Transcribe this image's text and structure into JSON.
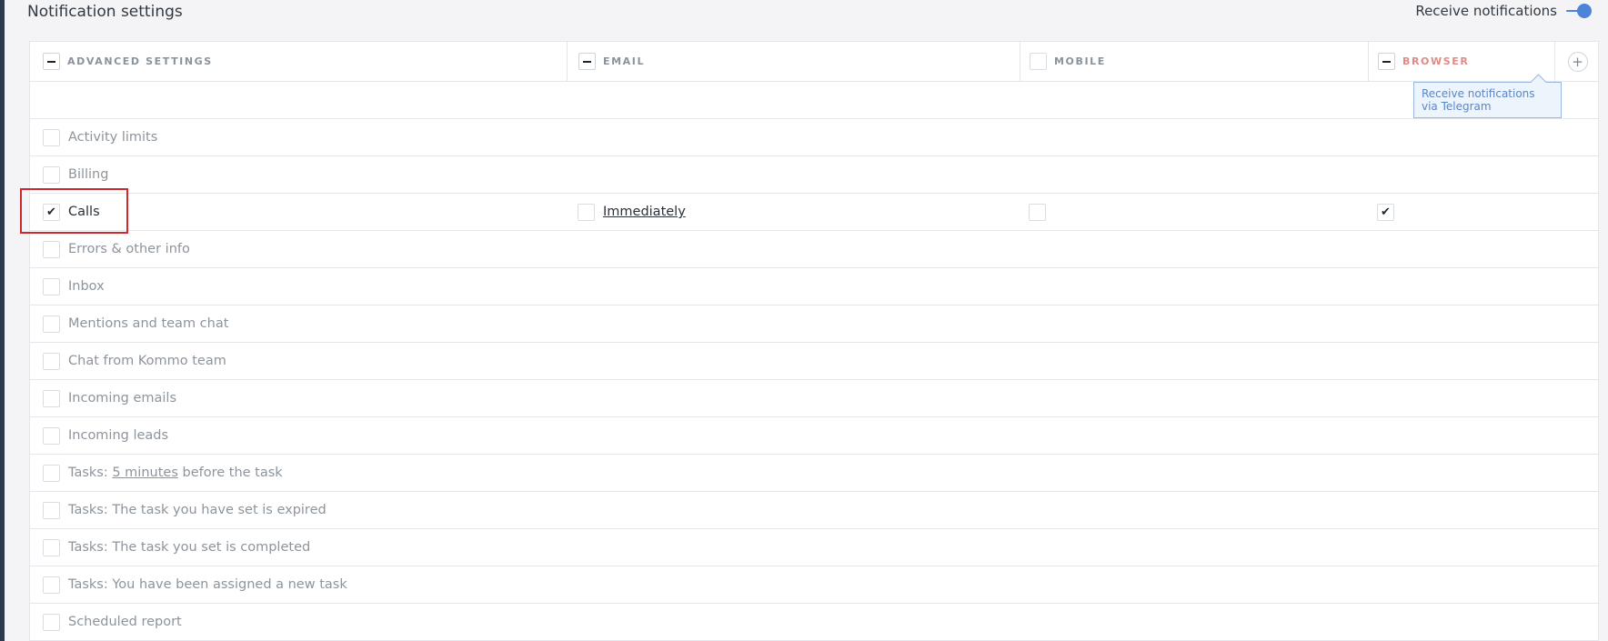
{
  "page": {
    "title": "Notification settings",
    "receive_label": "Receive notifications",
    "toggle_on": true,
    "accent_color": "#4d84d8"
  },
  "columns": {
    "advanced": "ADVANCED SETTINGS",
    "email": "EMAIL",
    "mobile": "MOBILE",
    "browser": "BROWSER"
  },
  "tooltip": {
    "text": "Receive notifications via Telegram"
  },
  "rows": [
    {
      "label": "Activity limits"
    },
    {
      "label": "Billing"
    },
    {
      "label": "Calls",
      "email_value": "Immediately"
    },
    {
      "label": "Errors & other info"
    },
    {
      "label": "Inbox"
    },
    {
      "label": "Mentions and team chat"
    },
    {
      "label": "Chat from Kommo team"
    },
    {
      "label": "Incoming emails"
    },
    {
      "label": "Incoming leads"
    },
    {
      "label_prefix": "Tasks:",
      "label_link": "5 minutes",
      "label_suffix": "before the task"
    },
    {
      "label": "Tasks: The task you have set is expired"
    },
    {
      "label": "Tasks: The task you set is completed"
    },
    {
      "label": "Tasks: You have been assigned a new task"
    },
    {
      "label": "Scheduled report"
    }
  ],
  "icons": {
    "checkmark": "✔",
    "plus": "+"
  }
}
